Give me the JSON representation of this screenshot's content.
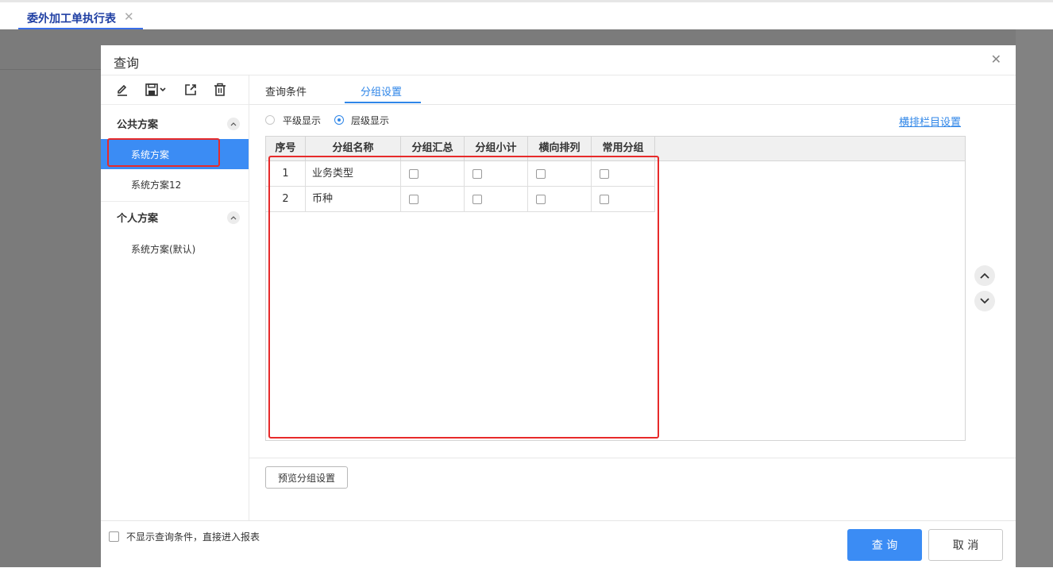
{
  "app_tabs": [
    {
      "label": "委外加工单执行表",
      "close": "✕"
    }
  ],
  "dialog": {
    "title": "查询",
    "close_icon": "close-icon"
  },
  "toolbar": {
    "icons": [
      "edit-icon",
      "save-dropdown-icon",
      "export-icon",
      "delete-icon"
    ]
  },
  "left_panel": {
    "public_group": {
      "label": "公共方案",
      "items": [
        "系统方案",
        "系统方案12"
      ],
      "active_index": 0
    },
    "personal_group": {
      "label": "个人方案",
      "items": [
        "系统方案(默认)"
      ]
    }
  },
  "tabs": [
    {
      "label": "查询条件"
    },
    {
      "label": "分组设置",
      "active": true
    }
  ],
  "display_mode": {
    "options": [
      "平级显示",
      "层级显示"
    ],
    "selected": "层级显示"
  },
  "column_settings_link": "横排栏目设置",
  "grid": {
    "columns": [
      "序号",
      "分组名称",
      "分组汇总",
      "分组小计",
      "横向排列",
      "常用分组"
    ],
    "rows": [
      {
        "index": "1",
        "name": "业务类型",
        "summary": false,
        "subtotal": false,
        "horizontal": false,
        "common": false
      },
      {
        "index": "2",
        "name": "币种",
        "summary": false,
        "subtotal": false,
        "horizontal": false,
        "common": false
      }
    ]
  },
  "preview_button": "预览分组设置",
  "footer": {
    "skip_conditions_label": "不显示查询条件，直接进入报表",
    "skip_conditions_checked": false,
    "query_button": "查 询",
    "cancel_button": "取 消"
  },
  "colors": {
    "accent": "#3b8cf4",
    "link": "#2f86e8",
    "highlight_red": "#e72a2a"
  }
}
